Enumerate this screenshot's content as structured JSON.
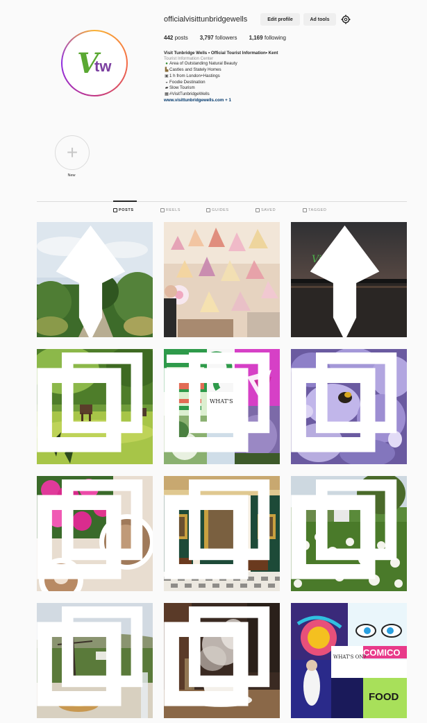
{
  "profile": {
    "username": "officialvisittunbridgewells",
    "edit_label": "Edit profile",
    "ad_label": "Ad tools",
    "settings_icon": "gear-icon",
    "avatar_logo_text": "Vtw"
  },
  "stats": {
    "posts_count": "442",
    "posts_label": "posts",
    "followers_count": "3,797",
    "followers_label": "followers",
    "following_count": "1,169",
    "following_label": "following"
  },
  "bio": {
    "name": "Visit Tunbridge Wells • Official Tourist Information• Kent",
    "category": "Tourist Information Center",
    "lines": [
      {
        "icon": "tree-icon",
        "text": "Area of Outstanding Natural Beauty"
      },
      {
        "icon": "castle-icon",
        "text": "Castles and Stately Homes"
      },
      {
        "icon": "train-icon",
        "text": "1 h from London+Hastings"
      },
      {
        "icon": "food-icon",
        "text": "Foodie Destination"
      },
      {
        "icon": "car-icon",
        "text": "Slow Tourism"
      },
      {
        "icon": "hashtag-icon",
        "text": "#VisitTunbridgeWells"
      }
    ],
    "link": "www.visittunbridgewells.com + 1"
  },
  "highlight": {
    "label": "New"
  },
  "tabs": [
    {
      "label": "POSTS",
      "active": true
    },
    {
      "label": "REELS",
      "active": false
    },
    {
      "label": "GUIDES",
      "active": false
    },
    {
      "label": "SAVED",
      "active": false
    },
    {
      "label": "TAGGED",
      "active": false
    }
  ],
  "posts": [
    {
      "subject": "garden-path",
      "badge": "pin-icon"
    },
    {
      "subject": "hanging-decorations",
      "badge": ""
    },
    {
      "subject": "sunset-lake",
      "badge": "pin-icon",
      "overlay_text_1": "Visit",
      "overlay_text_2": "tunbridgewells"
    },
    {
      "subject": "horses-field",
      "badge": "carousel-icon"
    },
    {
      "subject": "collage",
      "badge": "carousel-icon",
      "whats_on": "WHAT'S ON?"
    },
    {
      "subject": "wisteria-bee",
      "badge": "carousel-icon"
    },
    {
      "subject": "flowers-coffee",
      "badge": "carousel-icon"
    },
    {
      "subject": "green-room",
      "badge": "carousel-icon"
    },
    {
      "subject": "wildflowers",
      "badge": "carousel-icon"
    },
    {
      "subject": "terrace-view",
      "badge": "carousel-icon"
    },
    {
      "subject": "coffee-cup",
      "badge": "carousel-icon"
    },
    {
      "subject": "events-collage",
      "badge": "",
      "comic": "COMICO",
      "food": "FOOD",
      "whats_on": "WHAT'S ON?"
    }
  ]
}
